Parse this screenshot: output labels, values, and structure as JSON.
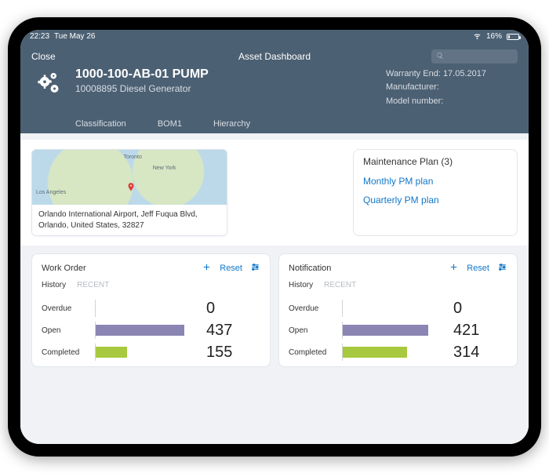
{
  "statusbar": {
    "time": "22:23",
    "date": "Tue May 26",
    "battery_pct": "16%"
  },
  "header": {
    "close": "Close",
    "title": "Asset Dashboard",
    "asset_name": "1000-100-AB-01 PUMP",
    "asset_desc": "10008895 Diesel Generator",
    "meta": {
      "warranty_label": "Warranty End:",
      "warranty_value": "17.05.2017",
      "manufacturer_label": "Manufacturer:",
      "manufacturer_value": "",
      "model_label": "Model number:",
      "model_value": ""
    },
    "tabs": {
      "classification": "Classification",
      "bom": "BOM1",
      "hierarchy": "Hierarchy"
    }
  },
  "location": {
    "address": "Orlando International Airport, Jeff Fuqua Blvd, Orlando, United States, 32827",
    "map_labels": {
      "toronto": "Toronto",
      "newyork": "New York",
      "la": "Los Angeles"
    }
  },
  "maintenance_plan": {
    "heading": "Maintenance Plan (3)",
    "items": [
      "Monthly PM plan",
      "Quarterly PM plan"
    ]
  },
  "panels": {
    "reset": "Reset",
    "history": "History",
    "recent": "RECENT",
    "rows": {
      "overdue": "Overdue",
      "open": "Open",
      "completed": "Completed"
    },
    "work_order": {
      "title": "Work Order"
    },
    "notification": {
      "title": "Notification"
    }
  },
  "chart_data": [
    {
      "type": "bar",
      "title": "Work Order",
      "categories": [
        "Overdue",
        "Open",
        "Completed"
      ],
      "values": [
        0,
        437,
        155
      ],
      "colors": [
        "#8a85b3",
        "#8a85b3",
        "#a7c93f"
      ],
      "xlim": [
        0,
        500
      ]
    },
    {
      "type": "bar",
      "title": "Notification",
      "categories": [
        "Overdue",
        "Open",
        "Completed"
      ],
      "values": [
        0,
        421,
        314
      ],
      "colors": [
        "#8a85b3",
        "#8a85b3",
        "#a7c93f"
      ],
      "xlim": [
        0,
        500
      ]
    }
  ]
}
